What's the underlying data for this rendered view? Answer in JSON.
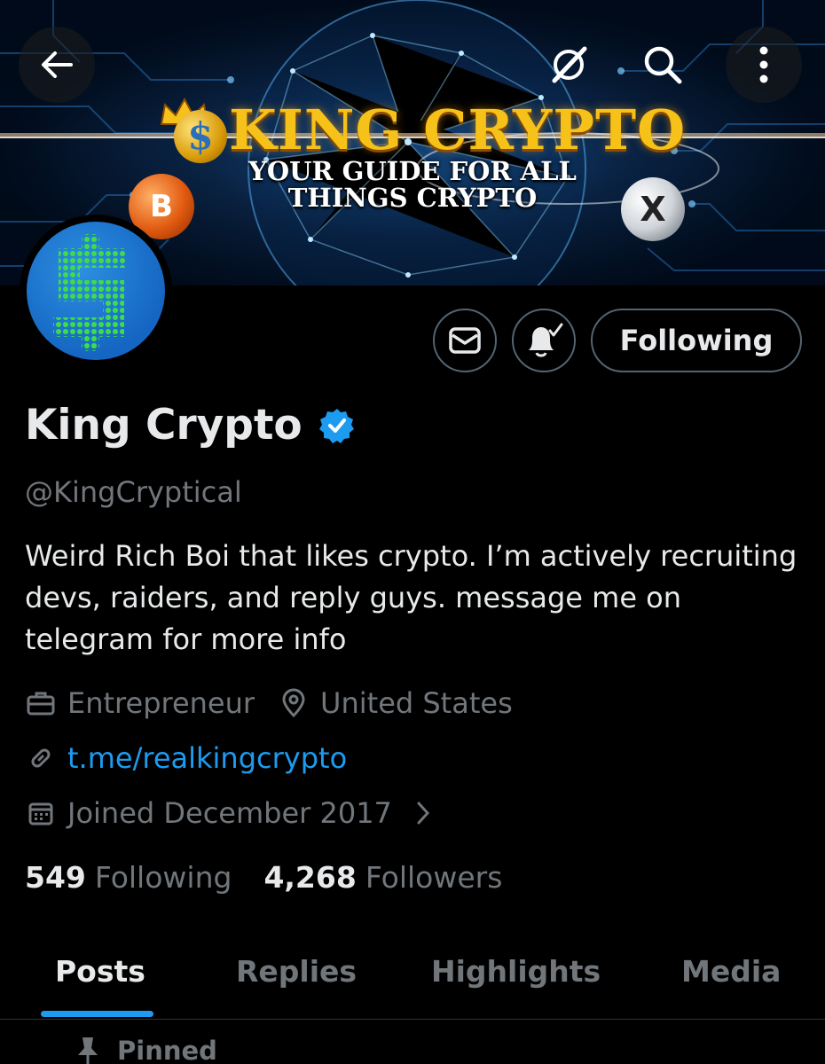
{
  "banner": {
    "title": "KING CRYPTO",
    "subtitle": "YOUR GUIDE FOR ALL THINGS CRYPTO",
    "coin_s": "$",
    "coin_btc": "B",
    "coin_xrp": "X"
  },
  "nav": {
    "back_icon": "arrow-left-icon",
    "grok_icon": "grok-icon",
    "search_icon": "search-icon",
    "more_icon": "more-vertical-icon"
  },
  "avatar": {
    "letter": "$"
  },
  "actions": {
    "message_icon": "mail-icon",
    "notify_icon": "bell-check-icon",
    "follow_label": "Following"
  },
  "profile": {
    "display_name": "King Crypto",
    "verified": true,
    "handle": "@KingCryptical",
    "bio": "Weird Rich Boi that likes crypto. I’m actively recruiting devs, raiders, and reply guys. message me on telegram for more info",
    "profession": "Entrepreneur",
    "location": "United States",
    "link": "t.me/realkingcrypto",
    "joined": "Joined December 2017"
  },
  "stats": {
    "following_count": "549",
    "following_label": "Following",
    "followers_count": "4,268",
    "followers_label": "Followers"
  },
  "tabs": [
    {
      "label": "Posts",
      "active": true
    },
    {
      "label": "Replies",
      "active": false
    },
    {
      "label": "Highlights",
      "active": false
    },
    {
      "label": "Media",
      "active": false
    }
  ],
  "pinned_label": "Pinned",
  "colors": {
    "accent": "#1d9bf0",
    "secondary_text": "#71767b",
    "primary_text": "#e7e9ea",
    "border": "#536471"
  }
}
